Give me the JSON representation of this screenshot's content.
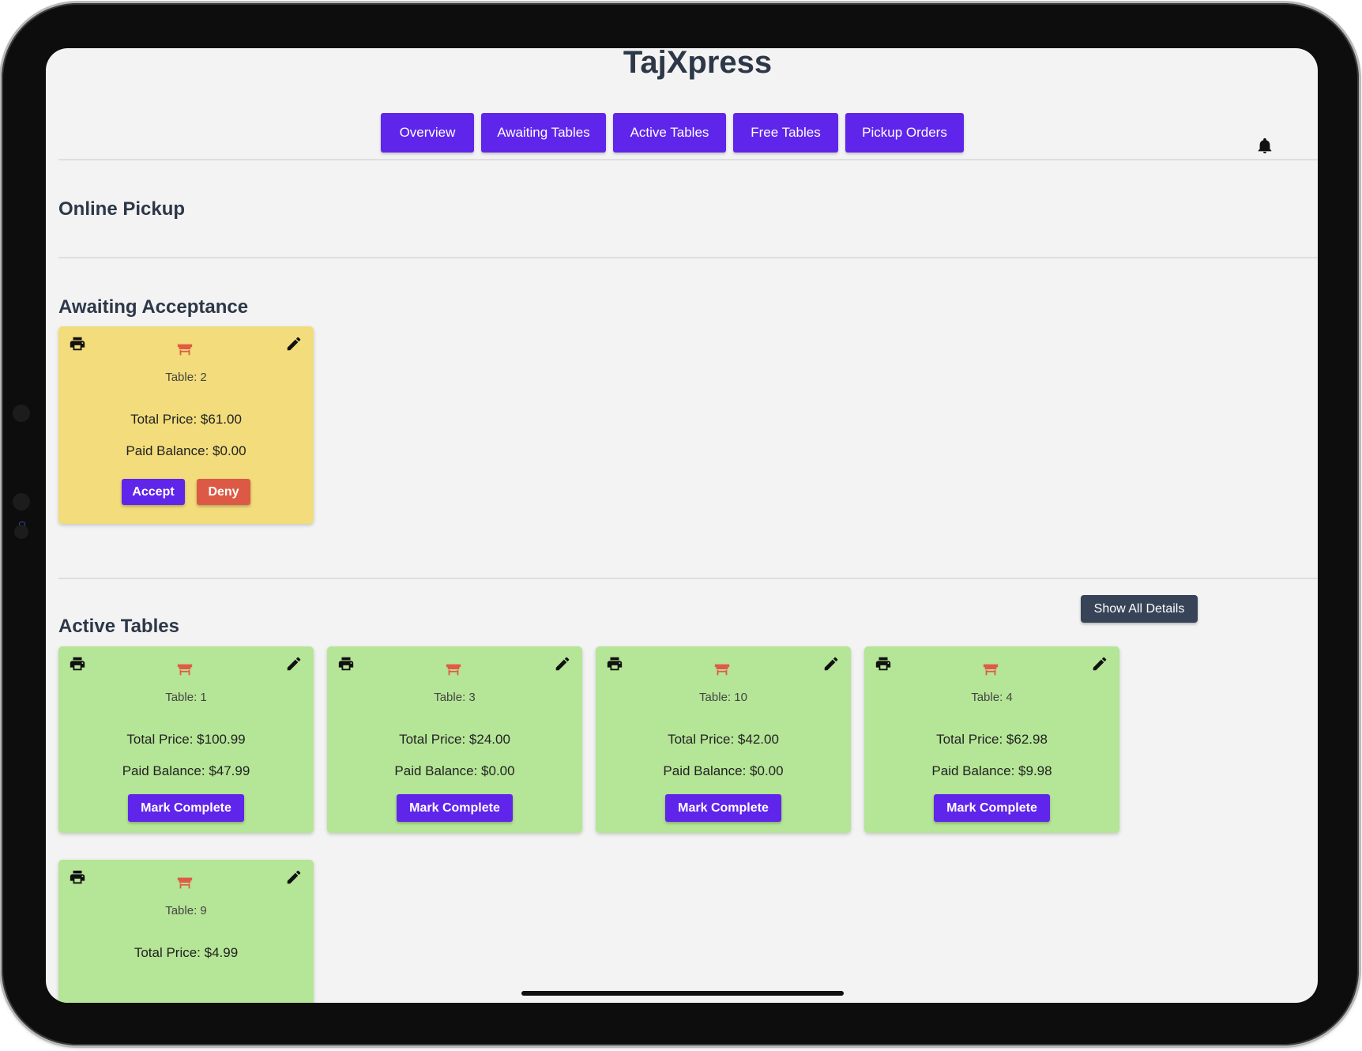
{
  "app": {
    "title": "TajXpress"
  },
  "nav": {
    "items": [
      {
        "label": "Overview"
      },
      {
        "label": "Awaiting Tables"
      },
      {
        "label": "Active Tables"
      },
      {
        "label": "Free Tables"
      },
      {
        "label": "Pickup Orders"
      }
    ]
  },
  "icons": {
    "bell": "bell-icon",
    "print": "printer-icon",
    "edit": "pencil-icon",
    "table": "table-icon"
  },
  "colors": {
    "accent": "#6025ea",
    "deny": "#dc5a45",
    "awaiting_card": "#f2dc7b",
    "active_card": "#b5e597",
    "dark_button": "#374458",
    "chair": "#e05a45",
    "heading": "#2d3748"
  },
  "sections": {
    "online_pickup": {
      "title": "Online Pickup"
    },
    "awaiting": {
      "title": "Awaiting Acceptance",
      "cards": [
        {
          "table": "Table: 2",
          "total": "Total Price: $61.00",
          "paid": "Paid Balance: $0.00",
          "accept": "Accept",
          "deny": "Deny"
        }
      ]
    },
    "active": {
      "title": "Active Tables",
      "show_all": "Show All Details",
      "cards": [
        {
          "table": "Table: 1",
          "total": "Total Price: $100.99",
          "paid": "Paid Balance: $47.99",
          "action": "Mark Complete"
        },
        {
          "table": "Table: 3",
          "total": "Total Price: $24.00",
          "paid": "Paid Balance: $0.00",
          "action": "Mark Complete"
        },
        {
          "table": "Table: 10",
          "total": "Total Price: $42.00",
          "paid": "Paid Balance: $0.00",
          "action": "Mark Complete"
        },
        {
          "table": "Table: 4",
          "total": "Total Price: $62.98",
          "paid": "Paid Balance: $9.98",
          "action": "Mark Complete"
        },
        {
          "table": "Table: 9",
          "total": "Total Price: $4.99"
        }
      ]
    }
  }
}
